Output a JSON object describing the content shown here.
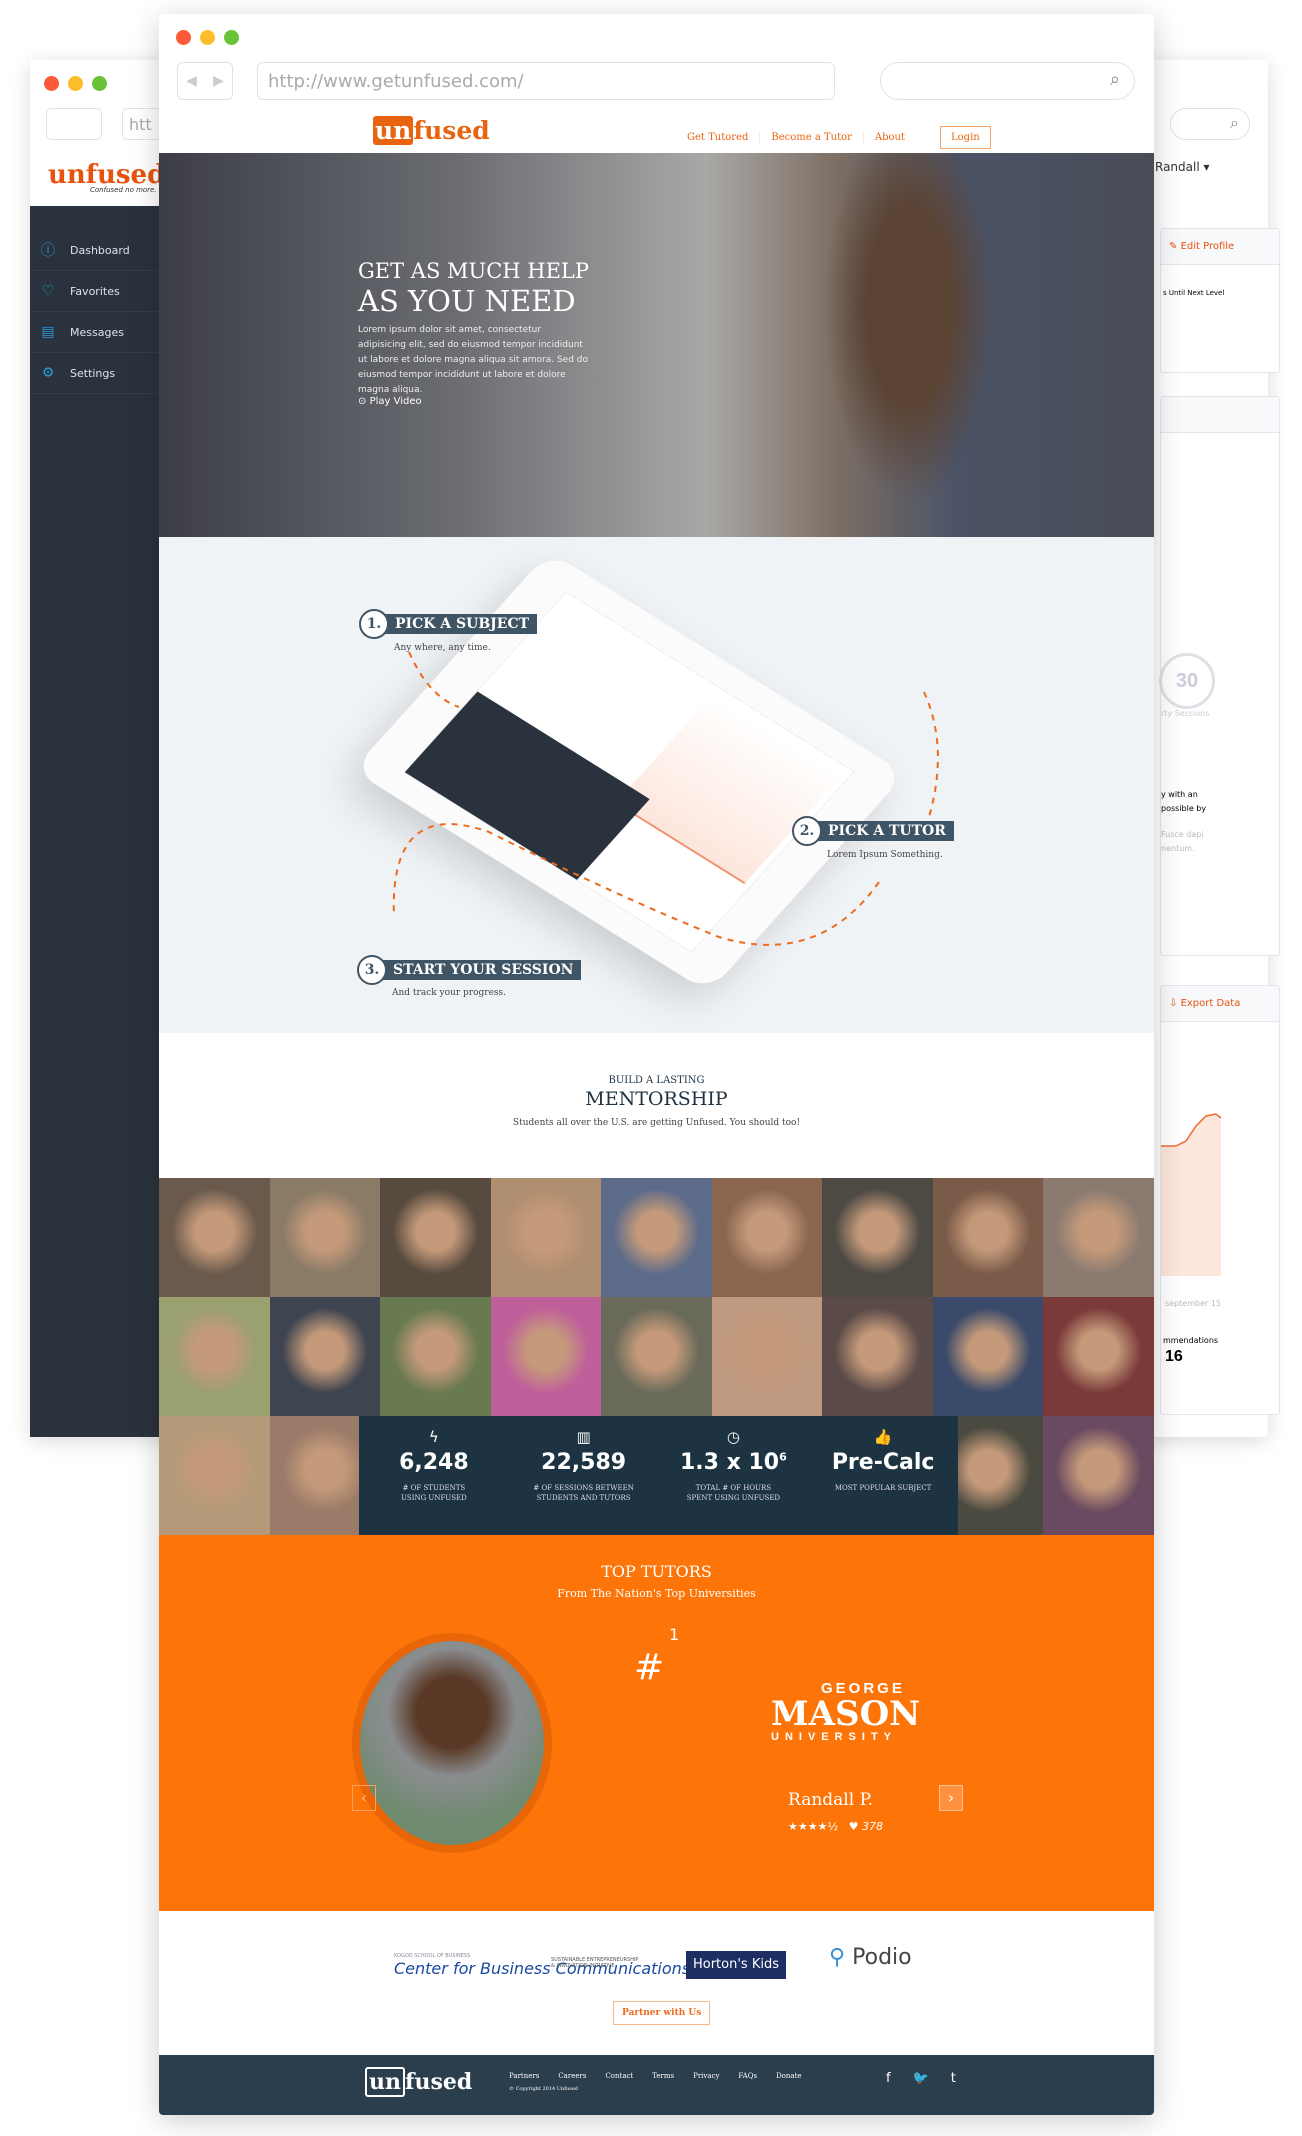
{
  "colors": {
    "accent": "#e8640f",
    "orange": "#fd7508",
    "navy": "#1d3342",
    "sidebar": "#2a323d"
  },
  "back_window": {
    "logo": "unfused",
    "tagline": "Confused no more.",
    "user": "Randall",
    "sidebar": [
      {
        "label": "Dashboard",
        "icon": "dashboard-icon"
      },
      {
        "label": "Favorites",
        "icon": "heart-icon"
      },
      {
        "label": "Messages",
        "icon": "messages-icon"
      },
      {
        "label": "Settings",
        "icon": "gear-icon"
      }
    ],
    "edit_profile": "Edit Profile",
    "next_level": "s Until Next Level",
    "sessions_badge": "30",
    "sessions_label": "rty Sessions",
    "text1": "y with an",
    "text2": "possible by",
    "text3": "Fusce dapi",
    "text4": "nentum.",
    "export": "Export Data",
    "chart_label": "september 15",
    "recommend_label": "mmendations",
    "recommend_value": "16",
    "url_stub": "htt"
  },
  "browser": {
    "url": "http://www.getunfused.com/"
  },
  "header": {
    "logo": "unfused",
    "nav": [
      "Get Tutored",
      "Become a Tutor",
      "About"
    ],
    "login": "Login"
  },
  "hero": {
    "title_light1": "GET AS MUCH ",
    "title_bold1": "HELP",
    "title_light2": "AS YOU ",
    "title_bold2": "NEED",
    "body": "Lorem ipsum dolor sit amet, consectetur adipisicing elit, sed do eiusmod tempor incididunt ut labore et dolore magna aliqua sit amora. Sed do eiusmod tempor incididunt ut labore et dolore magna aliqua.",
    "play": "Play Video"
  },
  "steps": [
    {
      "num": "1.",
      "title": "PICK A SUBJECT",
      "sub": "Any where, any time."
    },
    {
      "num": "2.",
      "title": "PICK A TUTOR",
      "sub": "Lorem Ipsum Something."
    },
    {
      "num": "3.",
      "title": "START YOUR SESSION",
      "sub": "And track your progress."
    }
  ],
  "mentorship": {
    "kicker": "BUILD A LASTING",
    "title": "MENTORSHIP",
    "sub": "Students all over the U.S. are getting Unfused. You should too!"
  },
  "stats": [
    {
      "icon": "lightning-icon",
      "glyph": "ϟ",
      "value": "6,248",
      "label1": "# OF STUDENTS",
      "label2": "USING UNFUSED"
    },
    {
      "icon": "bar-chart-icon",
      "glyph": "▥",
      "value": "22,589",
      "label1": "# OF SESSIONS BETWEEN",
      "label2": "STUDENTS AND TUTORS"
    },
    {
      "icon": "clock-icon",
      "glyph": "◷",
      "value": "1.3 x 10",
      "sup": "6",
      "label1": "TOTAL # OF HOURS",
      "label2": "SPENT USING UNFUSED"
    },
    {
      "icon": "thumbs-up-icon",
      "glyph": "👍",
      "value": "Pre-Calc",
      "label1": "MOST POPULAR SUBJECT",
      "label2": ""
    }
  ],
  "top_tutors": {
    "title": "TOP TUTORS",
    "sub": "From The Nation's Top Universities",
    "rank_hash": "#",
    "rank": "1",
    "university_top": "GEORGE",
    "university_mid": "MASON",
    "university_bot": "UNIVERSITY",
    "name": "Randall P.",
    "rating": 4.5,
    "stars": "★★★★½",
    "likes": "378"
  },
  "partners": {
    "logos": [
      "KOGOD SCHOOL OF BUSINESS",
      "Center for Business Communications",
      "SUSTAINABLE ENTREPRENEURSHIP & INNOVATION INITIATIVE",
      "Horton's Kids",
      "Podio"
    ],
    "cta": "Partner with Us"
  },
  "footer": {
    "logo": "unfused",
    "links": [
      "Partners",
      "Careers",
      "Contact",
      "Terms",
      "Privacy",
      "FAQs",
      "Donate"
    ],
    "copyright": "© Copyright 2014 Unfused",
    "social": [
      "f",
      "t-bird",
      "t"
    ]
  }
}
